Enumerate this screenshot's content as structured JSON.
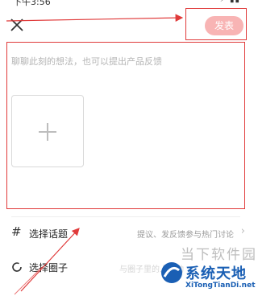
{
  "status_bar": {
    "time": "下午3:56",
    "icons": "⚡ ▮▮"
  },
  "header": {
    "publish_label": "发表"
  },
  "compose": {
    "placeholder": "聊聊此刻的想法，也可以提出产品反馈"
  },
  "topic": {
    "label": "选择话题",
    "hint": "提议、发反馈参与热门讨论"
  },
  "circle": {
    "label": "选择圈子",
    "hint": "与圈子里的人互动"
  },
  "watermark": {
    "top_text": "当下软件园",
    "main_text": "系统天地",
    "sub_text": "XiTongTianDi.net"
  },
  "colors": {
    "annotation_red": "#e03a3a",
    "publish_bg": "#f8b4b4",
    "brand_blue": "#1a5fb4"
  },
  "icons": [
    "close-icon",
    "plus-icon",
    "hash-icon",
    "chevron-right-icon",
    "circle-icon"
  ]
}
